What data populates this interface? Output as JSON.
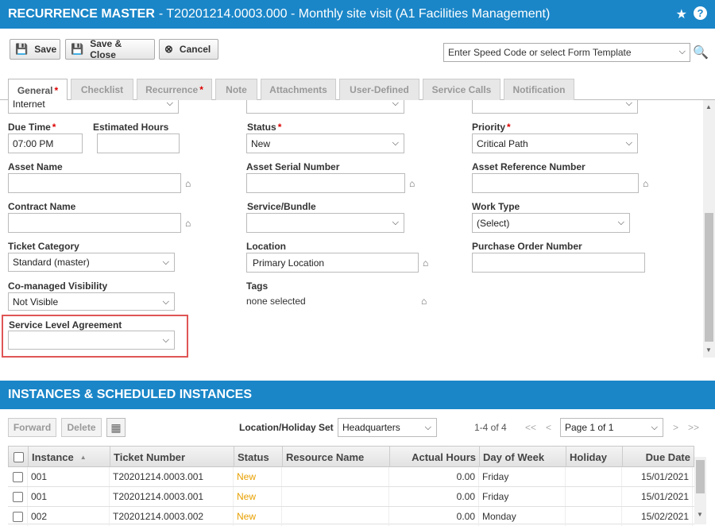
{
  "title": {
    "strong": "RECURRENCE MASTER",
    "rest": "- T20201214.0003.000 - Monthly site visit (A1 Facilities Management)",
    "star_icon": "star-icon",
    "help_icon": "help-icon",
    "help_glyph": "?"
  },
  "toolbar": {
    "save": "Save",
    "save_close": "Save & Close",
    "cancel": "Cancel",
    "speed_code_placeholder": "Enter Speed Code or select Form Template"
  },
  "tabs": [
    {
      "label": "General",
      "required": true
    },
    {
      "label": "Checklist",
      "required": false
    },
    {
      "label": "Recurrence",
      "required": true
    },
    {
      "label": "Note",
      "required": false
    },
    {
      "label": "Attachments",
      "required": false
    },
    {
      "label": "User-Defined",
      "required": false
    },
    {
      "label": "Service Calls",
      "required": false
    },
    {
      "label": "Notification",
      "required": false
    }
  ],
  "required_mark": "*",
  "form": {
    "top_row": {
      "col1_value": "Internet",
      "col2_value": "",
      "col3_value": ""
    },
    "due_time": {
      "label": "Due Time",
      "value": "07:00 PM"
    },
    "estimated_hours": {
      "label": "Estimated Hours",
      "value": ""
    },
    "status": {
      "label": "Status",
      "value": "New"
    },
    "priority": {
      "label": "Priority",
      "value": "Critical Path"
    },
    "asset_name": {
      "label": "Asset Name",
      "value": ""
    },
    "asset_serial": {
      "label": "Asset Serial Number",
      "value": ""
    },
    "asset_reference": {
      "label": "Asset Reference Number",
      "value": ""
    },
    "contract_name": {
      "label": "Contract Name",
      "value": ""
    },
    "service_bundle": {
      "label": "Service/Bundle",
      "value": ""
    },
    "work_type": {
      "label": "Work Type",
      "value": "(Select)"
    },
    "ticket_category": {
      "label": "Ticket Category",
      "value": "Standard (master)"
    },
    "location": {
      "label": "Location",
      "value": "Primary Location"
    },
    "purchase_order": {
      "label": "Purchase Order Number",
      "value": ""
    },
    "comanaged": {
      "label": "Co-managed Visibility",
      "value": "Not Visible"
    },
    "tags": {
      "label": "Tags",
      "value": "none selected"
    },
    "sla": {
      "label": "Service Level Agreement",
      "value": ""
    }
  },
  "instances": {
    "section_title": "INSTANCES & SCHEDULED INSTANCES",
    "forward": "Forward",
    "delete": "Delete",
    "location_holiday_label": "Location/Holiday Set",
    "location_holiday_value": "Headquarters",
    "count": "1-4 of 4",
    "first": "<<",
    "prev": "<",
    "page": "Page 1 of 1",
    "next": ">",
    "last": ">>",
    "sort_indicator": "▲",
    "columns": [
      "Instance",
      "Ticket Number",
      "Status",
      "Resource Name",
      "Actual Hours",
      "Day of Week",
      "Holiday",
      "Due Date"
    ],
    "rows": [
      {
        "instance": "001",
        "ticket": "T20201214.0003.001",
        "status": "New",
        "resource": "",
        "hours": "0.00",
        "day": "Friday",
        "holiday": "",
        "due": "15/01/2021"
      },
      {
        "instance": "001",
        "ticket": "T20201214.0003.001",
        "status": "New",
        "resource": "",
        "hours": "0.00",
        "day": "Friday",
        "holiday": "",
        "due": "15/01/2021"
      },
      {
        "instance": "002",
        "ticket": "T20201214.0003.002",
        "status": "New",
        "resource": "",
        "hours": "0.00",
        "day": "Monday",
        "holiday": "",
        "due": "15/02/2021"
      }
    ]
  },
  "colors": {
    "header_blue": "#1a86c8",
    "required_red": "#dd0000",
    "status_new": "#e8a000",
    "highlight": "#e05555"
  }
}
